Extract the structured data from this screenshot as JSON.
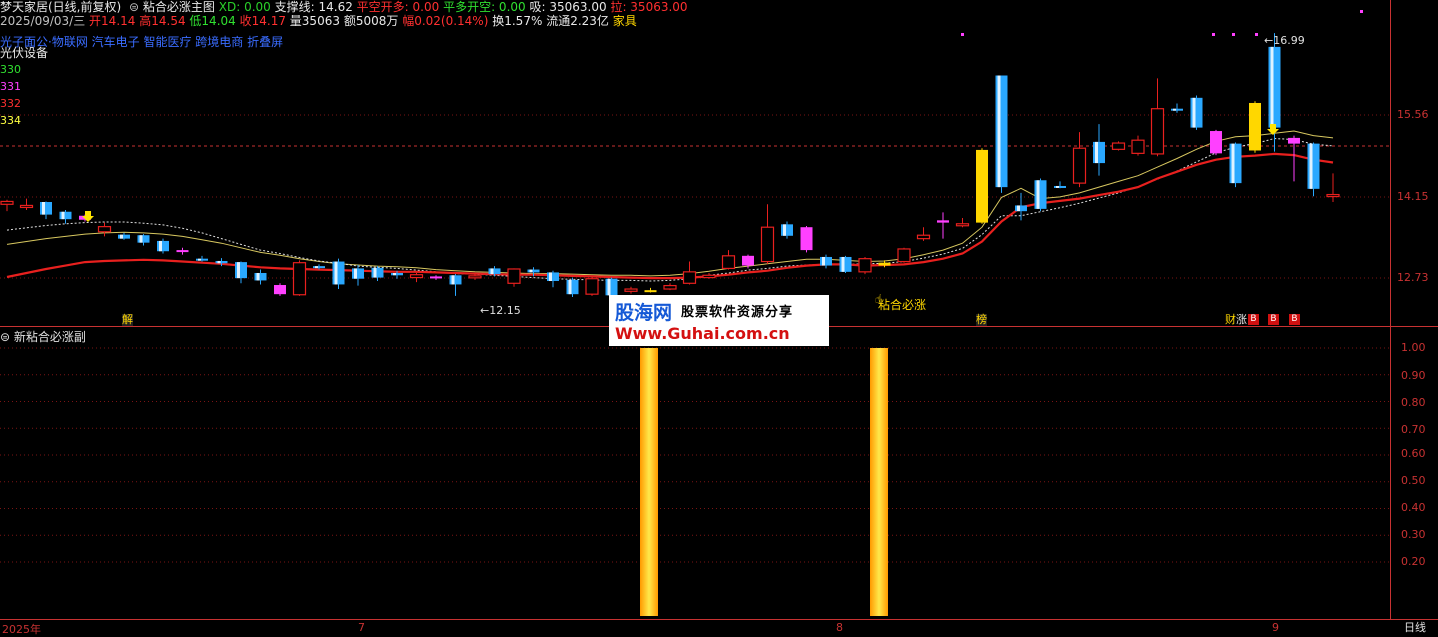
{
  "header": {
    "stock_name": "梦天家居(日线,前复权)",
    "indicator_name": "粘合必涨主图",
    "xd_label": "XD: 0.00",
    "support_label": "支撑线: 14.62",
    "pkdd_label": "平空开多: 0.00",
    "pdkk_label": "平多开空: 0.00",
    "xi_label": "吸: 35063.00",
    "la_label": "拉: 35063.00"
  },
  "quote": {
    "date": "2025/09/03/三",
    "open": "开14.14",
    "high": "高14.54",
    "low": "低14.04",
    "close": "收14.17",
    "volume": "量35063",
    "amount": "额5008万",
    "change": "幅0.02(0.14%)",
    "turnover": "换1.57%",
    "float_cap": "流通2.23亿",
    "industry": "家具"
  },
  "concepts": {
    "text": "光子面公·物联网 汽车电子 智能医疗 跨境电商 折叠屏",
    "sector": "光伏设备"
  },
  "legend": [
    "330",
    "331",
    "332",
    "334"
  ],
  "price_axis": [
    "15.56",
    "14.15",
    "12.73"
  ],
  "annotations": {
    "high_price": "16.99",
    "low_price": "12.15",
    "signal_label": "粘合必涨",
    "tags": [
      "解",
      "榜",
      "财",
      "涨"
    ],
    "badges": [
      "B",
      "B",
      "B"
    ]
  },
  "sub_panel": {
    "title": "新粘合必涨副",
    "axis": [
      "1.00",
      "0.90",
      "0.80",
      "0.70",
      "0.60",
      "0.50",
      "0.40",
      "0.30",
      "0.20"
    ],
    "signals": [
      1.0,
      1.0
    ]
  },
  "bottom_axis": {
    "labels": [
      "2025年",
      "7",
      "8",
      "9"
    ],
    "period": "日线"
  },
  "watermark": {
    "brand": "股海网",
    "slogan": "股票软件资源分享",
    "url": "Www.Guhai.com.cn"
  },
  "colors": {
    "up": "#e8201e",
    "down": "#2aa8ff",
    "signal": "#ffd700",
    "accent_red": "#c83232",
    "magenta": "#ff40ff"
  },
  "candles": [
    {
      "o": 14.0,
      "c": 14.05,
      "h": 14.08,
      "l": 13.88
    },
    {
      "o": 13.96,
      "c": 13.98,
      "h": 14.1,
      "l": 13.9
    },
    {
      "o": 14.04,
      "c": 13.82,
      "h": 14.05,
      "l": 13.74
    },
    {
      "o": 13.87,
      "c": 13.74,
      "h": 13.9,
      "l": 13.66
    },
    {
      "o": 13.73,
      "c": 13.8,
      "h": 13.82,
      "l": 13.7
    },
    {
      "o": 13.52,
      "c": 13.61,
      "h": 13.68,
      "l": 13.44
    },
    {
      "o": 13.47,
      "c": 13.4,
      "h": 13.5,
      "l": 13.38
    },
    {
      "o": 13.46,
      "c": 13.33,
      "h": 13.48,
      "l": 13.28
    },
    {
      "o": 13.36,
      "c": 13.18,
      "h": 13.4,
      "l": 13.14
    },
    {
      "o": 13.2,
      "c": 13.17,
      "h": 13.24,
      "l": 13.12
    },
    {
      "o": 13.05,
      "c": 13.04,
      "h": 13.1,
      "l": 13.0
    },
    {
      "o": 13.01,
      "c": 12.97,
      "h": 13.06,
      "l": 12.92
    },
    {
      "o": 12.99,
      "c": 12.71,
      "h": 13.0,
      "l": 12.62
    },
    {
      "o": 12.8,
      "c": 12.67,
      "h": 12.86,
      "l": 12.6
    },
    {
      "o": 12.43,
      "c": 12.59,
      "h": 12.62,
      "l": 12.4
    },
    {
      "o": 12.42,
      "c": 12.98,
      "h": 13.02,
      "l": 12.4
    },
    {
      "o": 12.92,
      "c": 12.9,
      "h": 12.95,
      "l": 12.86
    },
    {
      "o": 13.0,
      "c": 12.6,
      "h": 13.05,
      "l": 12.52
    },
    {
      "o": 12.88,
      "c": 12.7,
      "h": 12.94,
      "l": 12.58
    },
    {
      "o": 12.89,
      "c": 12.72,
      "h": 12.92,
      "l": 12.66
    },
    {
      "o": 12.8,
      "c": 12.76,
      "h": 12.84,
      "l": 12.7
    },
    {
      "o": 12.72,
      "c": 12.77,
      "h": 12.8,
      "l": 12.64
    },
    {
      "o": 12.72,
      "c": 12.74,
      "h": 12.76,
      "l": 12.68
    },
    {
      "o": 12.76,
      "c": 12.6,
      "h": 12.78,
      "l": 12.4
    },
    {
      "o": 12.72,
      "c": 12.75,
      "h": 12.8,
      "l": 12.68
    },
    {
      "o": 12.88,
      "c": 12.78,
      "h": 12.92,
      "l": 12.74
    },
    {
      "o": 12.62,
      "c": 12.87,
      "h": 12.88,
      "l": 12.56
    },
    {
      "o": 12.86,
      "c": 12.81,
      "h": 12.9,
      "l": 12.74
    },
    {
      "o": 12.81,
      "c": 12.66,
      "h": 12.84,
      "l": 12.55
    },
    {
      "o": 12.68,
      "c": 12.43,
      "h": 12.72,
      "l": 12.38
    },
    {
      "o": 12.43,
      "c": 12.7,
      "h": 12.74,
      "l": 12.4
    },
    {
      "o": 12.7,
      "c": 12.41,
      "h": 12.72,
      "l": 12.38
    },
    {
      "o": 12.48,
      "c": 12.52,
      "h": 12.56,
      "l": 12.44
    },
    {
      "o": 12.48,
      "c": 12.5,
      "h": 12.54,
      "l": 12.46
    },
    {
      "o": 12.52,
      "c": 12.58,
      "h": 12.62,
      "l": 12.5
    },
    {
      "o": 12.62,
      "c": 12.82,
      "h": 13.0,
      "l": 12.6
    },
    {
      "o": 12.72,
      "c": 12.76,
      "h": 12.8,
      "l": 12.7
    },
    {
      "o": 12.88,
      "c": 13.1,
      "h": 13.2,
      "l": 12.86
    },
    {
      "o": 13.1,
      "c": 12.93,
      "h": 13.12,
      "l": 12.88
    },
    {
      "o": 13.0,
      "c": 13.6,
      "h": 14.0,
      "l": 12.96
    },
    {
      "o": 13.65,
      "c": 13.45,
      "h": 13.7,
      "l": 13.4
    },
    {
      "o": 13.6,
      "c": 13.2,
      "h": 13.62,
      "l": 13.16
    },
    {
      "o": 13.08,
      "c": 12.93,
      "h": 13.12,
      "l": 12.88
    },
    {
      "o": 13.08,
      "c": 12.82,
      "h": 13.1,
      "l": 12.8
    },
    {
      "o": 12.82,
      "c": 13.05,
      "h": 13.08,
      "l": 12.78
    },
    {
      "o": 12.93,
      "c": 12.98,
      "h": 13.02,
      "l": 12.9
    },
    {
      "o": 13.0,
      "c": 13.22,
      "h": 13.24,
      "l": 12.98
    },
    {
      "o": 13.4,
      "c": 13.46,
      "h": 13.6,
      "l": 13.36
    },
    {
      "o": 13.68,
      "c": 13.72,
      "h": 13.86,
      "l": 13.4
    },
    {
      "o": 13.64,
      "c": 13.66,
      "h": 13.76,
      "l": 13.6
    },
    {
      "o": 13.68,
      "c": 14.95,
      "h": 14.98,
      "l": 13.66
    },
    {
      "o": 16.25,
      "c": 14.3,
      "h": 16.25,
      "l": 14.2
    },
    {
      "o": 13.98,
      "c": 13.88,
      "h": 14.2,
      "l": 13.72
    },
    {
      "o": 14.42,
      "c": 13.92,
      "h": 14.45,
      "l": 13.88
    },
    {
      "o": 14.32,
      "c": 14.31,
      "h": 14.4,
      "l": 14.28
    },
    {
      "o": 14.37,
      "c": 14.98,
      "h": 15.26,
      "l": 14.3
    },
    {
      "o": 15.09,
      "c": 14.72,
      "h": 15.4,
      "l": 14.5
    },
    {
      "o": 14.96,
      "c": 15.07,
      "h": 15.1,
      "l": 14.94
    },
    {
      "o": 14.89,
      "c": 15.12,
      "h": 15.2,
      "l": 14.85
    },
    {
      "o": 14.88,
      "c": 15.67,
      "h": 16.2,
      "l": 14.84
    },
    {
      "o": 15.67,
      "c": 15.64,
      "h": 15.76,
      "l": 15.6
    },
    {
      "o": 15.86,
      "c": 15.34,
      "h": 15.9,
      "l": 15.3
    },
    {
      "o": 15.28,
      "c": 14.89,
      "h": 15.3,
      "l": 14.86
    },
    {
      "o": 15.06,
      "c": 14.37,
      "h": 15.08,
      "l": 14.3
    },
    {
      "o": 14.94,
      "c": 15.77,
      "h": 15.8,
      "l": 14.9
    },
    {
      "o": 16.75,
      "c": 15.34,
      "h": 16.99,
      "l": 14.92
    },
    {
      "o": 15.16,
      "c": 15.06,
      "h": 15.2,
      "l": 14.4
    },
    {
      "o": 15.06,
      "c": 14.27,
      "h": 15.08,
      "l": 14.14
    },
    {
      "o": 14.14,
      "c": 14.17,
      "h": 14.54,
      "l": 14.04
    }
  ],
  "ma_red": [
    12.73,
    12.8,
    12.87,
    12.93,
    12.99,
    13.01,
    13.02,
    13.03,
    13.02,
    13.0,
    12.98,
    12.96,
    12.93,
    12.9,
    12.88,
    12.87,
    12.86,
    12.85,
    12.84,
    12.83,
    12.82,
    12.82,
    12.81,
    12.8,
    12.79,
    12.78,
    12.77,
    12.77,
    12.76,
    12.75,
    12.74,
    12.73,
    12.72,
    12.71,
    12.71,
    12.72,
    12.74,
    12.77,
    12.81,
    12.84,
    12.89,
    12.93,
    12.95,
    12.95,
    12.93,
    12.94,
    12.95,
    12.99,
    13.05,
    13.14,
    13.35,
    13.7,
    13.95,
    14.02,
    14.06,
    14.1,
    14.16,
    14.22,
    14.3,
    14.45,
    14.57,
    14.69,
    14.78,
    14.83,
    14.85,
    14.88,
    14.86,
    14.78,
    14.73
  ],
  "ma_white": [
    13.55,
    13.59,
    13.63,
    13.66,
    13.68,
    13.69,
    13.69,
    13.67,
    13.64,
    13.58,
    13.5,
    13.4,
    13.3,
    13.2,
    13.14,
    13.07,
    13.01,
    12.97,
    12.92,
    12.9,
    12.88,
    12.85,
    12.82,
    12.79,
    12.78,
    12.76,
    12.74,
    12.72,
    12.7,
    12.69,
    12.68,
    12.67,
    12.67,
    12.66,
    12.67,
    12.7,
    12.76,
    12.8,
    12.85,
    12.88,
    12.92,
    12.94,
    12.95,
    12.95,
    12.96,
    12.97,
    13.0,
    13.06,
    13.13,
    13.23,
    13.47,
    13.8,
    13.8,
    13.87,
    13.94,
    14.02,
    14.11,
    14.2,
    14.31,
    14.44,
    14.58,
    14.74,
    14.9,
    15.0,
    15.06,
    15.15,
    15.13,
    15.05,
    15.02
  ],
  "ma_yellow": [
    13.3,
    13.35,
    13.4,
    13.44,
    13.48,
    13.5,
    13.51,
    13.5,
    13.48,
    13.44,
    13.38,
    13.32,
    13.24,
    13.16,
    13.11,
    13.05,
    13.0,
    12.96,
    12.94,
    12.92,
    12.91,
    12.89,
    12.86,
    12.84,
    12.82,
    12.81,
    12.8,
    12.79,
    12.79,
    12.78,
    12.77,
    12.76,
    12.76,
    12.75,
    12.76,
    12.79,
    12.83,
    12.88,
    12.92,
    12.96,
    13.0,
    13.04,
    13.04,
    13.02,
    13.0,
    13.01,
    13.05,
    13.12,
    13.2,
    13.32,
    13.6,
    14.12,
    14.28,
    14.1,
    14.13,
    14.2,
    14.3,
    14.4,
    14.5,
    14.65,
    14.8,
    14.96,
    15.1,
    15.18,
    15.2,
    15.24,
    15.28,
    15.2,
    15.16
  ]
}
